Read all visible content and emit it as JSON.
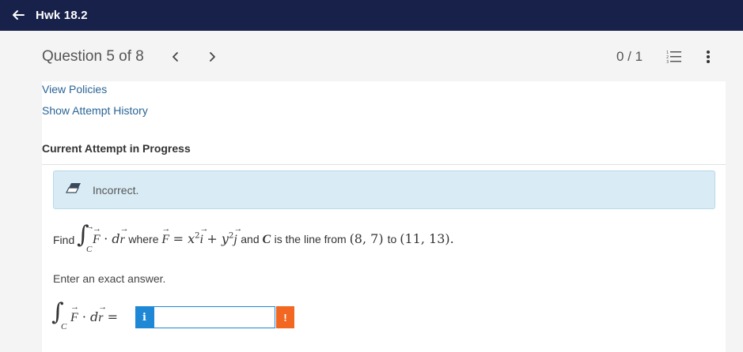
{
  "topbar": {
    "title": "Hwk 18.2",
    "back_icon": "arrow-left-icon"
  },
  "question_header": {
    "title": "Question 5 of 8",
    "prev_icon": "chevron-left-icon",
    "next_icon": "chevron-right-icon",
    "score": "0 / 1",
    "list_icon": "numbered-list-icon",
    "more_icon": "vertical-ellipsis-icon"
  },
  "links": {
    "view_policies": "View Policies",
    "show_attempt_history": "Show Attempt History"
  },
  "section": {
    "title": "Current Attempt in Progress"
  },
  "alert": {
    "text": "Incorrect.",
    "icon": "eraser-icon",
    "background": "#d9ecf5"
  },
  "problem": {
    "find": "Find",
    "where": "where",
    "and": "and",
    "is_the_line": "is the line from",
    "from_point": "(8, 7)",
    "to": "to",
    "to_point": "(11, 13).",
    "vector_field": "F = x²i + y²j",
    "curve": "C"
  },
  "instruction": "Enter an exact answer.",
  "answer": {
    "value": "",
    "info_label": "i",
    "warn_label": "!",
    "info_color": "#1e88d6",
    "warn_color": "#f26722"
  },
  "colors": {
    "topbar": "#172149",
    "link": "#2a6496"
  }
}
